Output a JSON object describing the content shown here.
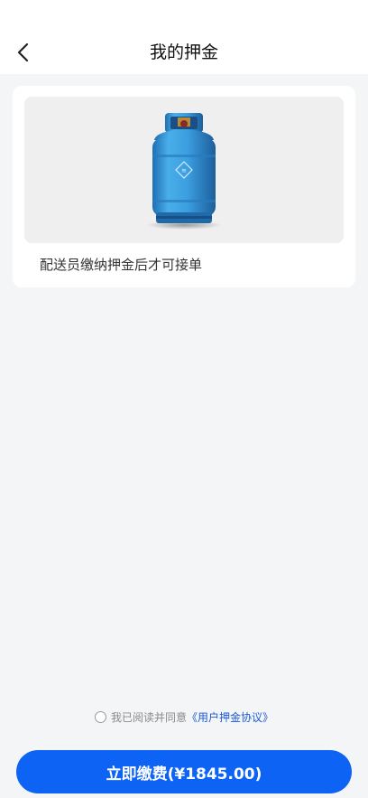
{
  "header": {
    "title": "我的押金",
    "back_icon": "chevron-left-icon"
  },
  "deposit_card": {
    "image": "gas-cylinder-image",
    "note": "配送员缴纳押金后才可接单"
  },
  "agreement": {
    "prefix": "我已阅读并同意",
    "link": "《用户押金协议》",
    "checked": false
  },
  "pay_button": {
    "label": "立即缴费(¥1845.00)"
  },
  "colors": {
    "primary": "#0d63f3",
    "link": "#1e5bd6",
    "background": "#f4f5f7",
    "cylinder": "#3a9be0"
  }
}
